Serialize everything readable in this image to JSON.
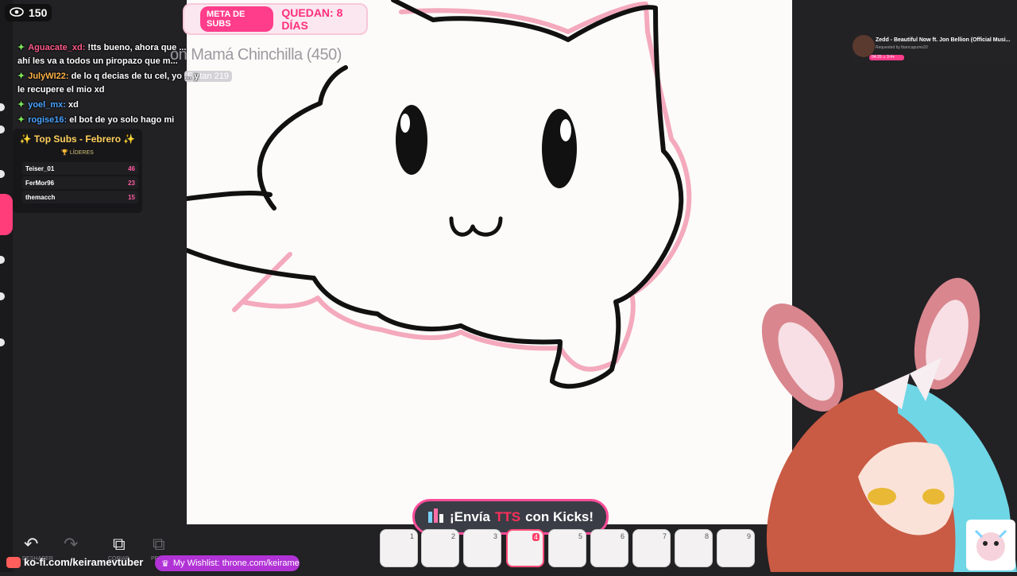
{
  "stream": {
    "viewer_count": "150",
    "chat": [
      {
        "user": "Aguacate_xd:",
        "user_color": "#ff5a8a",
        "text": "!tts bueno, ahora que ... ahí les va a todos un piropazo que m..."
      },
      {
        "user": "JulyWI22:",
        "user_color": "#ffb347",
        "text": "de lo q decias de tu cel, yo ... y le recupere el mio xd"
      },
      {
        "user": "yoel_mx:",
        "user_color": "#4aa3ff",
        "text": "xd"
      },
      {
        "user": "rogise16:",
        "user_color": "#4aa3ff",
        "text": "el bot de yo solo hago mi trabajo"
      }
    ],
    "top_subs": {
      "title": "✨ Top Subs - Febrero ✨",
      "subtitle": "🏆 LÍDERES",
      "rows": [
        {
          "name": "Teiser_01",
          "count": "46"
        },
        {
          "name": "FerMor96",
          "count": "23"
        },
        {
          "name": "themacch",
          "count": "15"
        }
      ]
    },
    "goal": {
      "badge": "META DE SUBS",
      "days": "QUEDAN: 8 DÍAS",
      "name": "on Mamá Chinchilla (450)",
      "remaining": "Faltan 219"
    },
    "song": {
      "title": "Zedd - Beautiful Now ft. Jon Bellion (Official Musi...",
      "requested": "Requested by lbarrcapumo20",
      "bar": "04:20 ♫ 3:4+"
    },
    "tts": {
      "prefix": "¡Envía",
      "emph": "TTS",
      "suffix": "con Kicks!"
    },
    "frames": [
      "1",
      "2",
      "3",
      "4",
      "5",
      "6",
      "7",
      "8",
      "9"
    ],
    "active_frame": "4",
    "tools": {
      "undo_label": "DESHACER",
      "copy_label": "COPIAR",
      "paste_label": "PEGAR"
    },
    "kofi": "ko-fi.com/keiramevtuber",
    "wishlist": "My Wishlist: throne.com/keirame"
  },
  "colors": {
    "accent": "#ff3d8a",
    "background": "#222124",
    "canvas": "#fcfbf9"
  }
}
